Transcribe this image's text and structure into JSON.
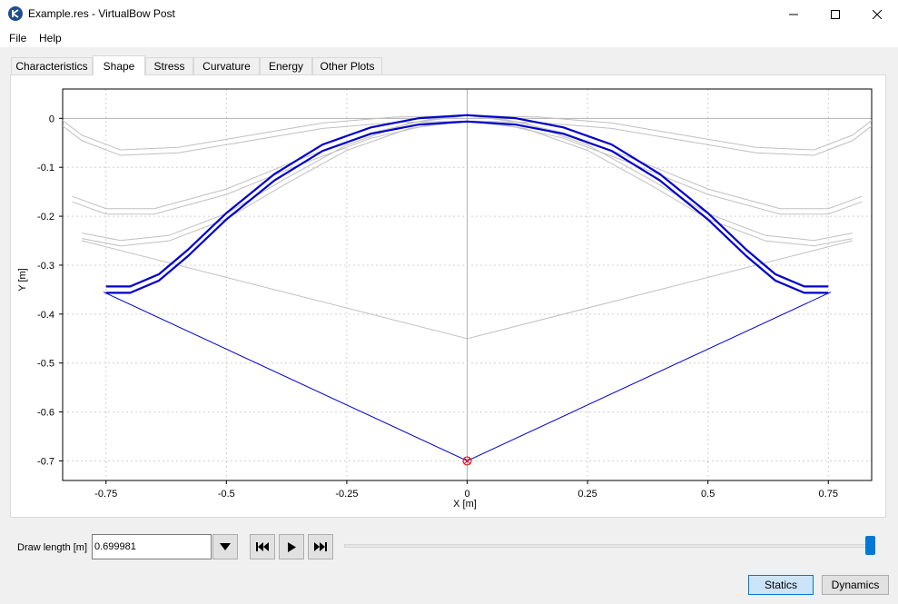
{
  "window": {
    "title": "Example.res - VirtualBow Post"
  },
  "menu": {
    "items": [
      "File",
      "Help"
    ]
  },
  "tabs": [
    "Characteristics",
    "Shape",
    "Stress",
    "Curvature",
    "Energy",
    "Other Plots"
  ],
  "active_tab": "Shape",
  "controls": {
    "draw_length_label": "Draw length [m]",
    "draw_length_value": "0.699981",
    "slider_fraction": 1.0,
    "statics_label": "Statics",
    "dynamics_label": "Dynamics",
    "active_mode": "Statics"
  },
  "chart_data": {
    "type": "line",
    "xlabel": "X [m]",
    "ylabel": "Y [m]",
    "xlim": [
      -0.84,
      0.84
    ],
    "ylim": [
      -0.74,
      0.06
    ],
    "x_ticks": [
      "-0.75",
      "-0.5",
      "-0.25",
      "0",
      "0.25",
      "0.5",
      "0.75"
    ],
    "x_tick_values": [
      -0.75,
      -0.5,
      -0.25,
      0,
      0.25,
      0.5,
      0.75
    ],
    "y_ticks": [
      "0",
      "-0.1",
      "-0.2",
      "-0.3",
      "-0.4",
      "-0.5",
      "-0.6",
      "-0.7"
    ],
    "y_tick_values": [
      0,
      -0.1,
      -0.2,
      -0.3,
      -0.4,
      -0.5,
      -0.6,
      -0.7
    ],
    "grid": true,
    "colors": {
      "current_limb": "#0000cc",
      "current_string": "#0000cc",
      "previous_states": "#c0c0c0",
      "arrow_marker": "#e00000"
    },
    "series": [
      {
        "role": "previous-limb-1",
        "x": [
          -0.84,
          -0.8,
          -0.72,
          -0.6,
          -0.45,
          -0.3,
          -0.15,
          0,
          0.15,
          0.3,
          0.45,
          0.6,
          0.72,
          0.8,
          0.84
        ],
        "y": [
          -0.01,
          -0.04,
          -0.07,
          -0.065,
          -0.04,
          -0.015,
          -0.003,
          0,
          -0.003,
          -0.015,
          -0.04,
          -0.065,
          -0.07,
          -0.04,
          -0.01
        ]
      },
      {
        "role": "previous-limb-2",
        "x": [
          -0.82,
          -0.75,
          -0.65,
          -0.5,
          -0.35,
          -0.2,
          -0.08,
          0,
          0.08,
          0.2,
          0.35,
          0.5,
          0.65,
          0.75,
          0.82
        ],
        "y": [
          -0.165,
          -0.19,
          -0.19,
          -0.15,
          -0.09,
          -0.035,
          -0.008,
          0,
          -0.008,
          -0.035,
          -0.09,
          -0.15,
          -0.19,
          -0.19,
          -0.165
        ]
      },
      {
        "role": "previous-limb-3",
        "x": [
          -0.8,
          -0.72,
          -0.62,
          -0.5,
          -0.38,
          -0.25,
          -0.12,
          0,
          0.12,
          0.25,
          0.38,
          0.5,
          0.62,
          0.72,
          0.8
        ],
        "y": [
          -0.24,
          -0.255,
          -0.245,
          -0.2,
          -0.13,
          -0.06,
          -0.015,
          0,
          -0.015,
          -0.06,
          -0.13,
          -0.2,
          -0.245,
          -0.255,
          -0.24
        ]
      },
      {
        "role": "previous-string-1",
        "x": [
          -0.8,
          0,
          0.8
        ],
        "y": [
          -0.25,
          -0.45,
          -0.25
        ]
      },
      {
        "role": "current-limb",
        "x": [
          -0.75,
          -0.7,
          -0.64,
          -0.58,
          -0.5,
          -0.4,
          -0.3,
          -0.2,
          -0.1,
          0,
          0.1,
          0.2,
          0.3,
          0.4,
          0.5,
          0.58,
          0.64,
          0.7,
          0.75
        ],
        "y": [
          -0.35,
          -0.35,
          -0.325,
          -0.275,
          -0.2,
          -0.12,
          -0.06,
          -0.025,
          -0.006,
          0,
          -0.006,
          -0.025,
          -0.06,
          -0.12,
          -0.2,
          -0.275,
          -0.325,
          -0.35,
          -0.35
        ]
      },
      {
        "role": "current-string",
        "x": [
          -0.755,
          0,
          0.755
        ],
        "y": [
          -0.355,
          -0.7,
          -0.355
        ]
      }
    ],
    "arrow_point": {
      "x": 0,
      "y": -0.7
    }
  }
}
